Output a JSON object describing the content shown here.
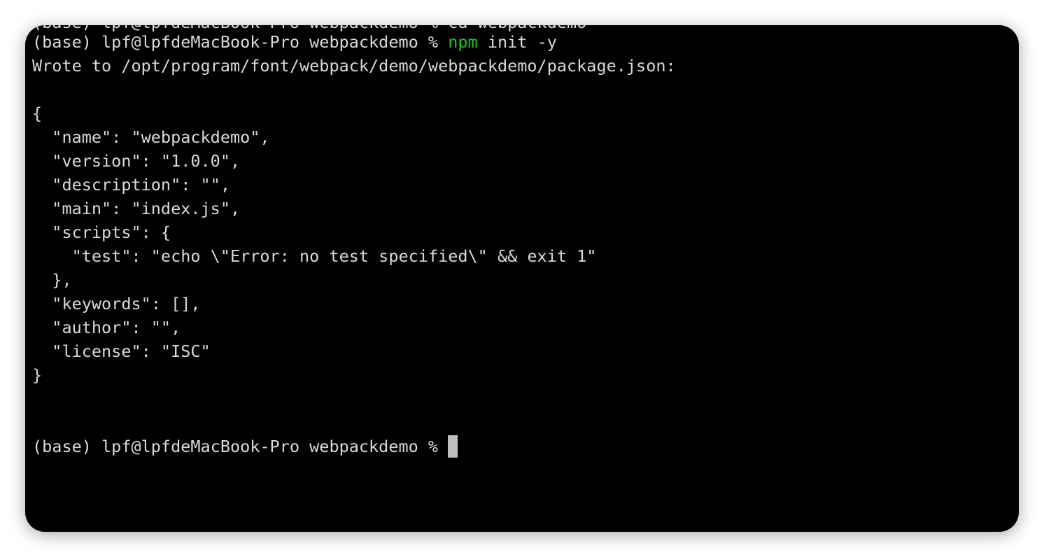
{
  "terminal": {
    "clipped_previous_line": "(base) lpf@lpfdeMacBook-Pro webpackdemo % cd webpackdemo",
    "prompt": "(base) lpf@lpfdeMacBook-Pro webpackdemo % ",
    "command_name": "npm",
    "command_args": " init -y",
    "wrote_line": "Wrote to /opt/program/font/webpack/demo/webpackdemo/package.json:",
    "json_lines": [
      "{",
      "  \"name\": \"webpackdemo\",",
      "  \"version\": \"1.0.0\",",
      "  \"description\": \"\",",
      "  \"main\": \"index.js\",",
      "  \"scripts\": {",
      "    \"test\": \"echo \\\"Error: no test specified\\\" && exit 1\"",
      "  },",
      "  \"keywords\": [],",
      "  \"author\": \"\",",
      "  \"license\": \"ISC\"",
      "}"
    ],
    "final_prompt": "(base) lpf@lpfdeMacBook-Pro webpackdemo % "
  },
  "colors": {
    "background": "#000000",
    "text": "#d9d9d9",
    "command_highlight": "#23c21b",
    "cursor": "#bfbfbf"
  }
}
